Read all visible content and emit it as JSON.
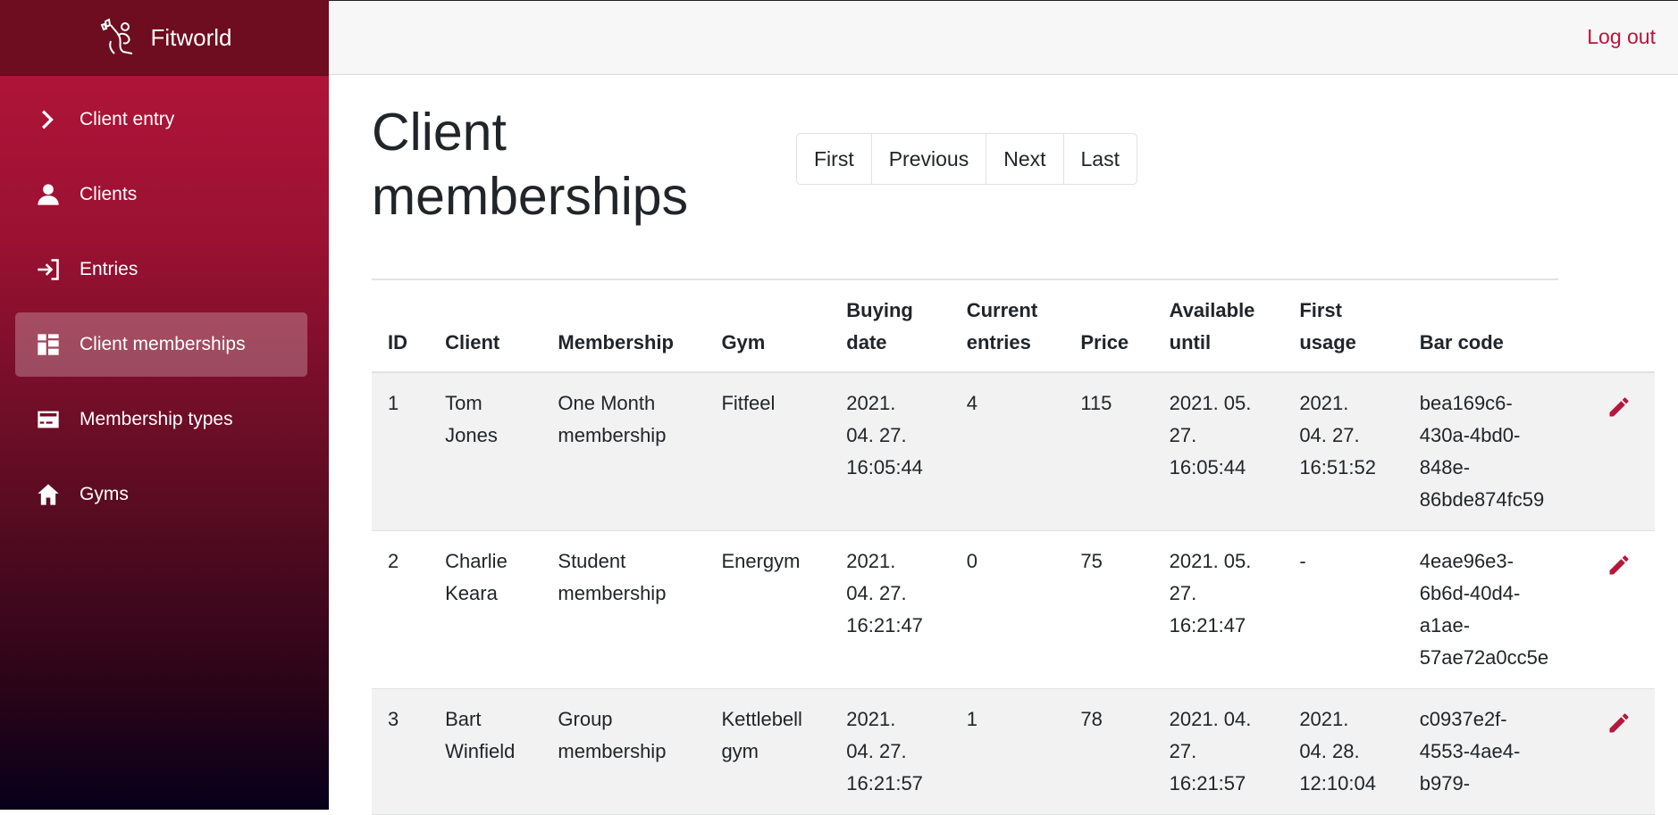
{
  "app": {
    "name": "Fitworld"
  },
  "topbar": {
    "logout_label": "Log out"
  },
  "sidebar": {
    "items": [
      {
        "label": "Client entry",
        "icon": "chevron-right-icon"
      },
      {
        "label": "Clients",
        "icon": "person-icon"
      },
      {
        "label": "Entries",
        "icon": "login-icon"
      },
      {
        "label": "Client memberships",
        "icon": "dashboard-icon",
        "active": true
      },
      {
        "label": "Membership types",
        "icon": "card-icon"
      },
      {
        "label": "Gyms",
        "icon": "home-icon"
      }
    ]
  },
  "main": {
    "title_line1": "Client",
    "title_line2": "memberships",
    "pagination": {
      "first": "First",
      "previous": "Previous",
      "next": "Next",
      "last": "Last"
    },
    "table": {
      "headers": {
        "id": "ID",
        "client": "Client",
        "membership": "Membership",
        "gym": "Gym",
        "buying_date_1": "Buying",
        "buying_date_2": "date",
        "current_entries_1": "Current",
        "current_entries_2": "entries",
        "price": "Price",
        "available_until_1": "Available",
        "available_until_2": "until",
        "first_usage_1": "First",
        "first_usage_2": "usage",
        "bar_code": "Bar code"
      },
      "rows": [
        {
          "id": "1",
          "client": [
            "Tom",
            "Jones"
          ],
          "membership": [
            "One Month",
            "membership"
          ],
          "gym": [
            "Fitfeel"
          ],
          "buying_date": [
            "2021.",
            "04. 27.",
            "16:05:44"
          ],
          "current_entries": "4",
          "price": "115",
          "available_until": [
            "2021. 05.",
            "27.",
            "16:05:44"
          ],
          "first_usage": [
            "2021.",
            "04. 27.",
            "16:51:52"
          ],
          "bar_code": [
            "bea169c6-",
            "430a-4bd0-",
            "848e-",
            "86bde874fc59"
          ]
        },
        {
          "id": "2",
          "client": [
            "Charlie",
            "Keara"
          ],
          "membership": [
            "Student",
            "membership"
          ],
          "gym": [
            "Energym"
          ],
          "buying_date": [
            "2021.",
            "04. 27.",
            "16:21:47"
          ],
          "current_entries": "0",
          "price": "75",
          "available_until": [
            "2021. 05.",
            "27.",
            "16:21:47"
          ],
          "first_usage": [
            "-"
          ],
          "bar_code": [
            "4eae96e3-",
            "6b6d-40d4-",
            "a1ae-",
            "57ae72a0cc5e"
          ]
        },
        {
          "id": "3",
          "client": [
            "Bart",
            "Winfield"
          ],
          "membership": [
            "Group",
            "membership"
          ],
          "gym": [
            "Kettlebell",
            "gym"
          ],
          "buying_date": [
            "2021.",
            "04. 27.",
            "16:21:57"
          ],
          "current_entries": "1",
          "price": "78",
          "available_until": [
            "2021. 04.",
            "27.",
            "16:21:57"
          ],
          "first_usage": [
            "2021.",
            "04. 28.",
            "12:10:04"
          ],
          "bar_code": [
            "c0937e2f-",
            "4553-4ae4-",
            "b979-"
          ]
        }
      ]
    }
  },
  "colors": {
    "accent": "#b8163a",
    "brand_bar": "#6d0d1f"
  }
}
